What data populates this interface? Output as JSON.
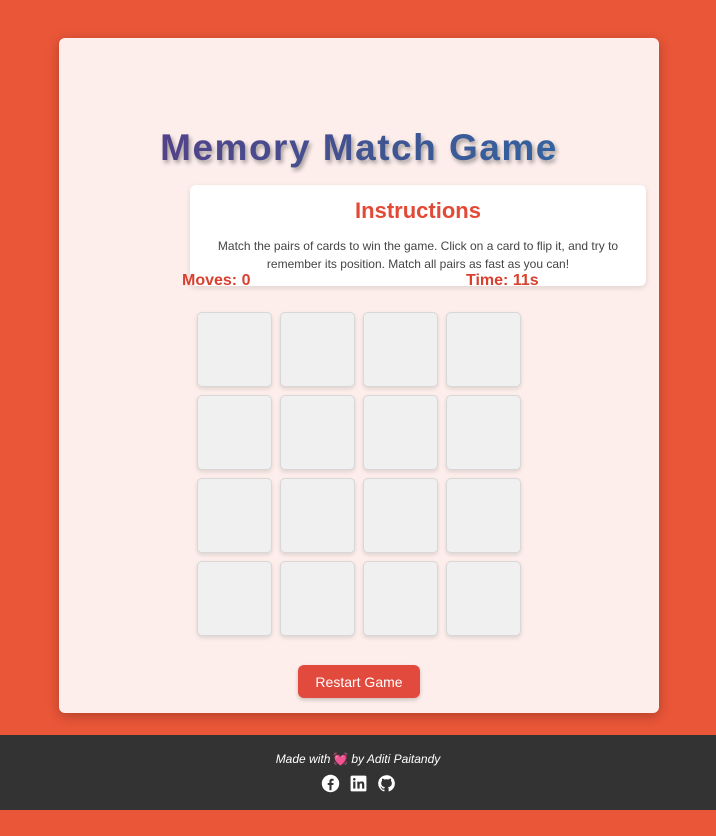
{
  "header": {
    "title": "Memory Match Game"
  },
  "instructions": {
    "heading": "Instructions",
    "text": "Match the pairs of cards to win the game. Click on a card to flip it, and try to remember its position. Match all pairs as fast as you can!"
  },
  "stats": {
    "moves": "Moves: 0",
    "time": "Time: 11s"
  },
  "board": {
    "rows": 4,
    "columns": 4,
    "cards_face_down": 16
  },
  "actions": {
    "restart_label": "Restart Game"
  },
  "footer": {
    "made_with": "Made with",
    "by": "by Aditi Paitandy",
    "heart_icon": "heart-icon",
    "social": [
      "facebook-icon",
      "linkedin-icon",
      "github-icon"
    ]
  },
  "colors": {
    "background": "#ea5638",
    "panel": "#fdeeeb",
    "accent": "#e24a37",
    "footer": "#333333"
  }
}
